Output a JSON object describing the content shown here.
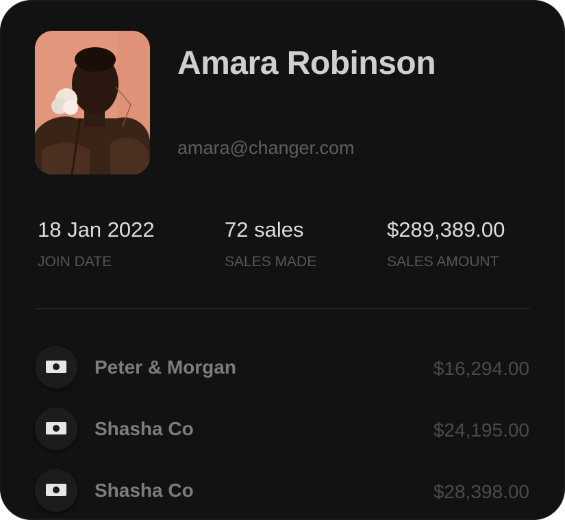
{
  "profile": {
    "name": "Amara Robinson",
    "email": "amara@changer.com"
  },
  "stats": [
    {
      "value": "18 Jan 2022",
      "label": "JOIN DATE"
    },
    {
      "value": "72 sales",
      "label": "SALES MADE"
    },
    {
      "value": "$289,389.00",
      "label": "SALES AMOUNT"
    }
  ],
  "transactions": [
    {
      "icon": "banknote-icon",
      "name": "Peter & Morgan",
      "amount": "$16,294.00"
    },
    {
      "icon": "banknote-icon",
      "name": "Shasha Co",
      "amount": "$24,195.00"
    },
    {
      "icon": "banknote-icon",
      "name": "Shasha Co",
      "amount": "$28,398.00"
    }
  ],
  "colors": {
    "card_background": "#121212",
    "avatar_background": "#e2977c",
    "primary_text": "#cfcfcf",
    "muted_text": "#5e5e5e"
  }
}
